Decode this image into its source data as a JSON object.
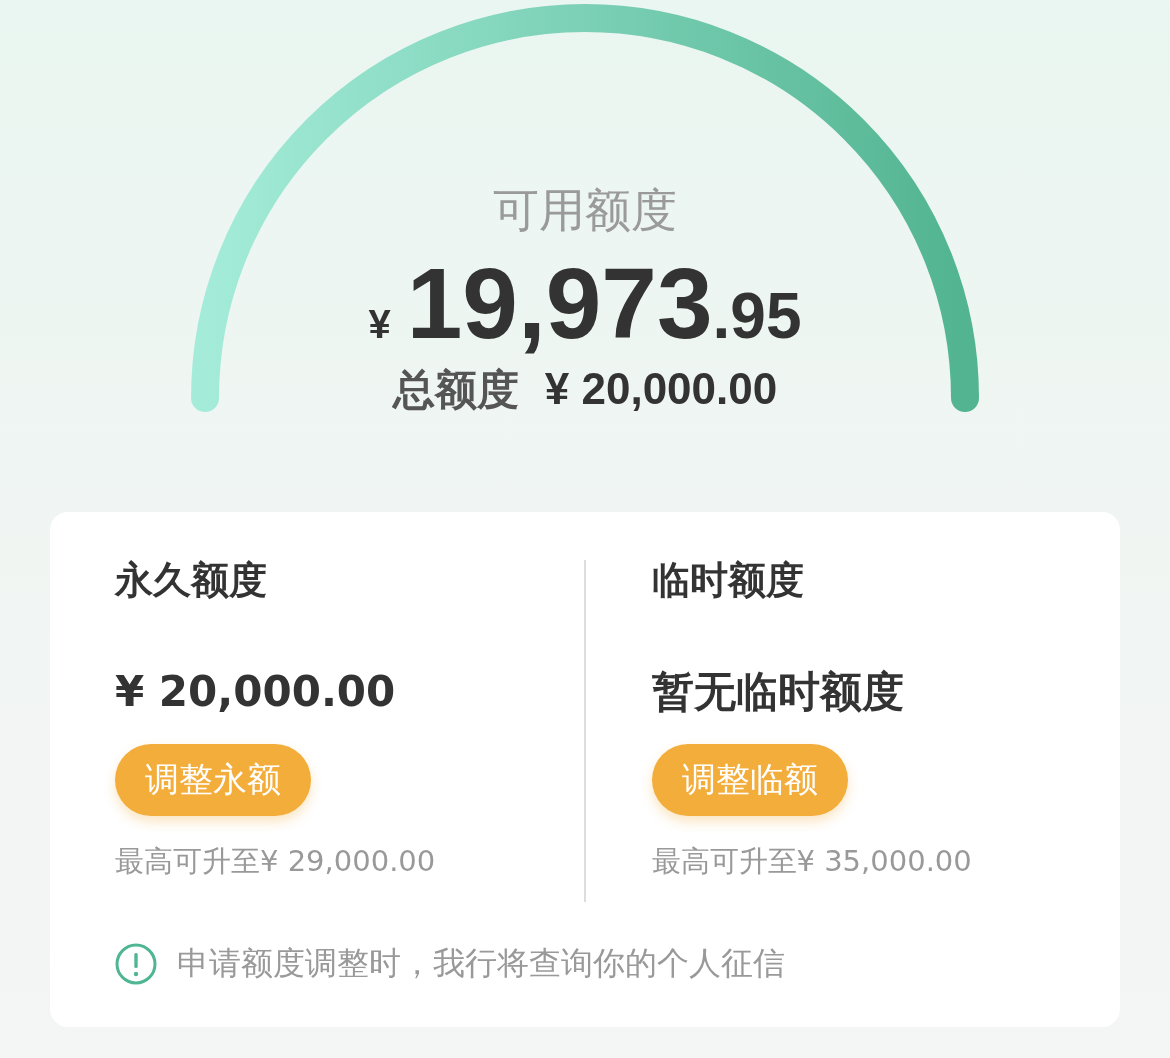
{
  "summary": {
    "label": "可用额度",
    "currency": "¥",
    "amount_integer": "19,973",
    "amount_decimal": ".95",
    "total_label": "总额度",
    "total_value": "¥ 20,000.00"
  },
  "limits": [
    {
      "title": "永久额度",
      "value": "¥ 20,000.00",
      "button": "调整永额",
      "note": "最高可升至¥ 29,000.00"
    },
    {
      "title": "临时额度",
      "value": "暂无临时额度",
      "button": "调整临额",
      "note": "最高可升至¥ 35,000.00"
    }
  ],
  "notice": "申请额度调整时，我行将查询你的个人征信"
}
